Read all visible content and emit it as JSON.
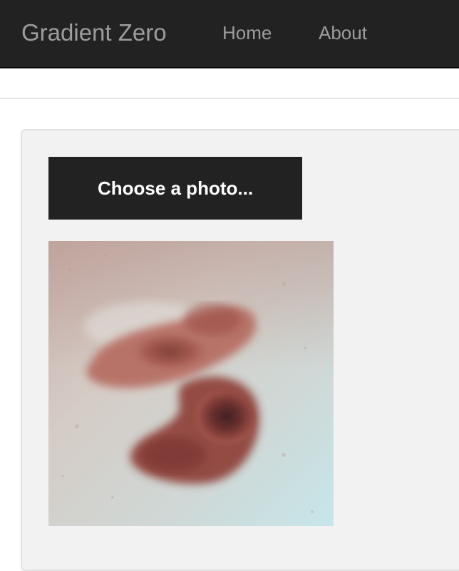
{
  "navbar": {
    "brand": "Gradient Zero",
    "links": [
      {
        "label": "Home"
      },
      {
        "label": "About"
      }
    ]
  },
  "upload": {
    "button_label": "Choose a photo..."
  },
  "colors": {
    "navbar_bg": "#222222",
    "nav_text": "#9d9d9d",
    "panel_bg": "#f2f2f2",
    "button_bg": "#222222",
    "button_text": "#ffffff"
  }
}
